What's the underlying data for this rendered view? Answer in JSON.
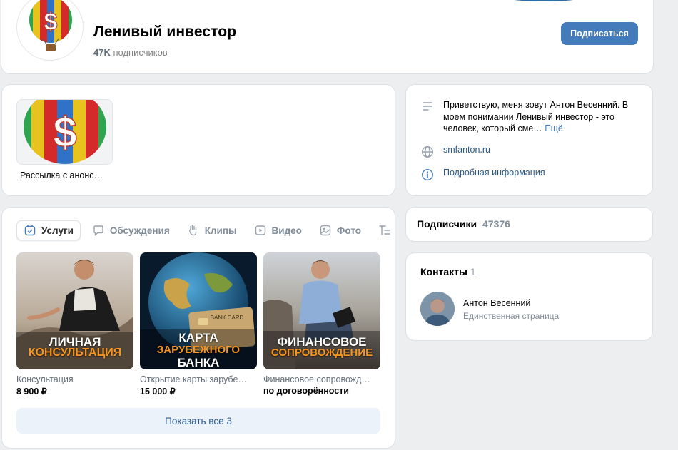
{
  "group": {
    "name": "Ленивый инвестор",
    "subscribers_short": "47K",
    "subscribers_suffix": " подписчиков",
    "subscribe_label": "Подписаться"
  },
  "newsletter": {
    "caption": "Рассылка с анонс…"
  },
  "about": {
    "description": "Приветствую, меня зовут Антон Весенний. В моем понимании Ленивый инвестор - это человек, который сме…",
    "more": "Ещё",
    "website": "smfanton.ru",
    "details": "Подробная информация"
  },
  "tabs": [
    {
      "label": "Услуги",
      "icon": "services-icon",
      "active": true
    },
    {
      "label": "Обсуждения",
      "icon": "discussions-icon"
    },
    {
      "label": "Клипы",
      "icon": "clips-icon"
    },
    {
      "label": "Видео",
      "icon": "video-icon"
    },
    {
      "label": "Фото",
      "icon": "photo-icon"
    },
    {
      "label": "",
      "icon": "more-list-icon"
    }
  ],
  "products": [
    {
      "title": "Консультация",
      "price": "8 900 ₽",
      "line1": "ЛИЧНАЯ",
      "line2": "КОНСУЛЬТАЦИЯ",
      "line3": ""
    },
    {
      "title": "Открытие карты зарубе…",
      "price": "15 000 ₽",
      "line1": "КАРТА",
      "line2": "ЗАРУБЕЖНОГО",
      "line3": "БАНКА",
      "card_text": "BANK CARD"
    },
    {
      "title": "Финансовое сопровожд…",
      "price": "по договорённости",
      "line1": "ФИНАНСОВОЕ",
      "line2": "СОПРОВОЖДЕНИЕ",
      "line3": ""
    }
  ],
  "show_all_label": "Показать все 3",
  "subscribers": {
    "label": "Подписчики",
    "count": "47376"
  },
  "contacts": {
    "title": "Контакты",
    "count": "1",
    "items": [
      {
        "name": "Антон Весенний",
        "role": "Единственная страница"
      }
    ]
  },
  "colors": {
    "accent": "#447bba",
    "background": "#edeef0",
    "price_highlight": "#f7941d"
  }
}
